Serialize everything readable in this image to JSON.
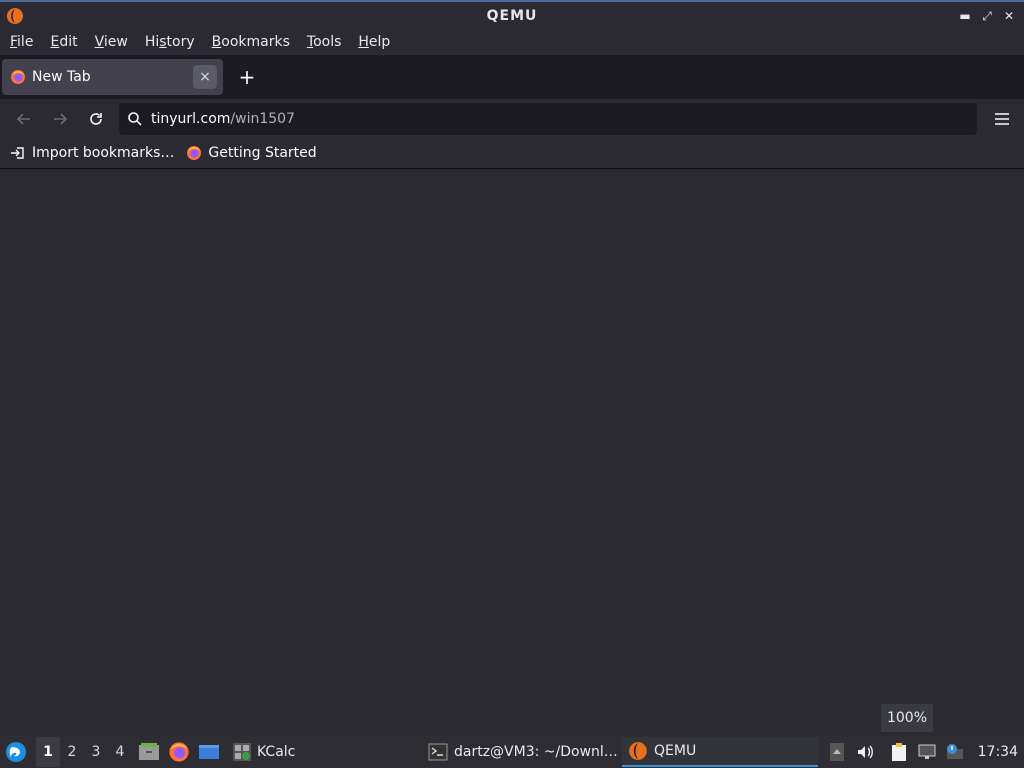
{
  "window": {
    "title": "QEMU"
  },
  "menubar": {
    "items": [
      {
        "label": "File",
        "accel": "F",
        "rest": "ile"
      },
      {
        "label": "Edit",
        "accel": "E",
        "rest": "dit"
      },
      {
        "label": "View",
        "accel": "V",
        "rest": "iew"
      },
      {
        "label": "History",
        "pre": "Hi",
        "accel": "s",
        "rest": "tory"
      },
      {
        "label": "Bookmarks",
        "accel": "B",
        "rest": "ookmarks"
      },
      {
        "label": "Tools",
        "accel": "T",
        "rest": "ools"
      },
      {
        "label": "Help",
        "accel": "H",
        "rest": "elp"
      }
    ]
  },
  "tabs": {
    "active": {
      "label": "New Tab",
      "close": "×"
    },
    "new_tab": "+"
  },
  "navbar": {
    "url_host": "tinyurl.com",
    "url_path": "/win1507"
  },
  "bookmarks": {
    "items": [
      {
        "label": "Import bookmarks…",
        "icon": "import-icon"
      },
      {
        "label": "Getting Started",
        "icon": "firefox-icon"
      }
    ]
  },
  "zoom": {
    "label": "100%"
  },
  "taskbar": {
    "workspaces": [
      "1",
      "2",
      "3",
      "4"
    ],
    "active_workspace": "1",
    "kcalc_label": "KCalc",
    "tasks": [
      {
        "label": "dartz@VM3: ~/Downl…",
        "icon": "terminal-icon"
      },
      {
        "label": "QEMU",
        "icon": "qemu-icon",
        "active": true
      }
    ],
    "clock": "17:34"
  },
  "colors": {
    "background": "#2b2a33",
    "tabstrip": "#1c1b22",
    "accent": "#3d8fd6"
  }
}
